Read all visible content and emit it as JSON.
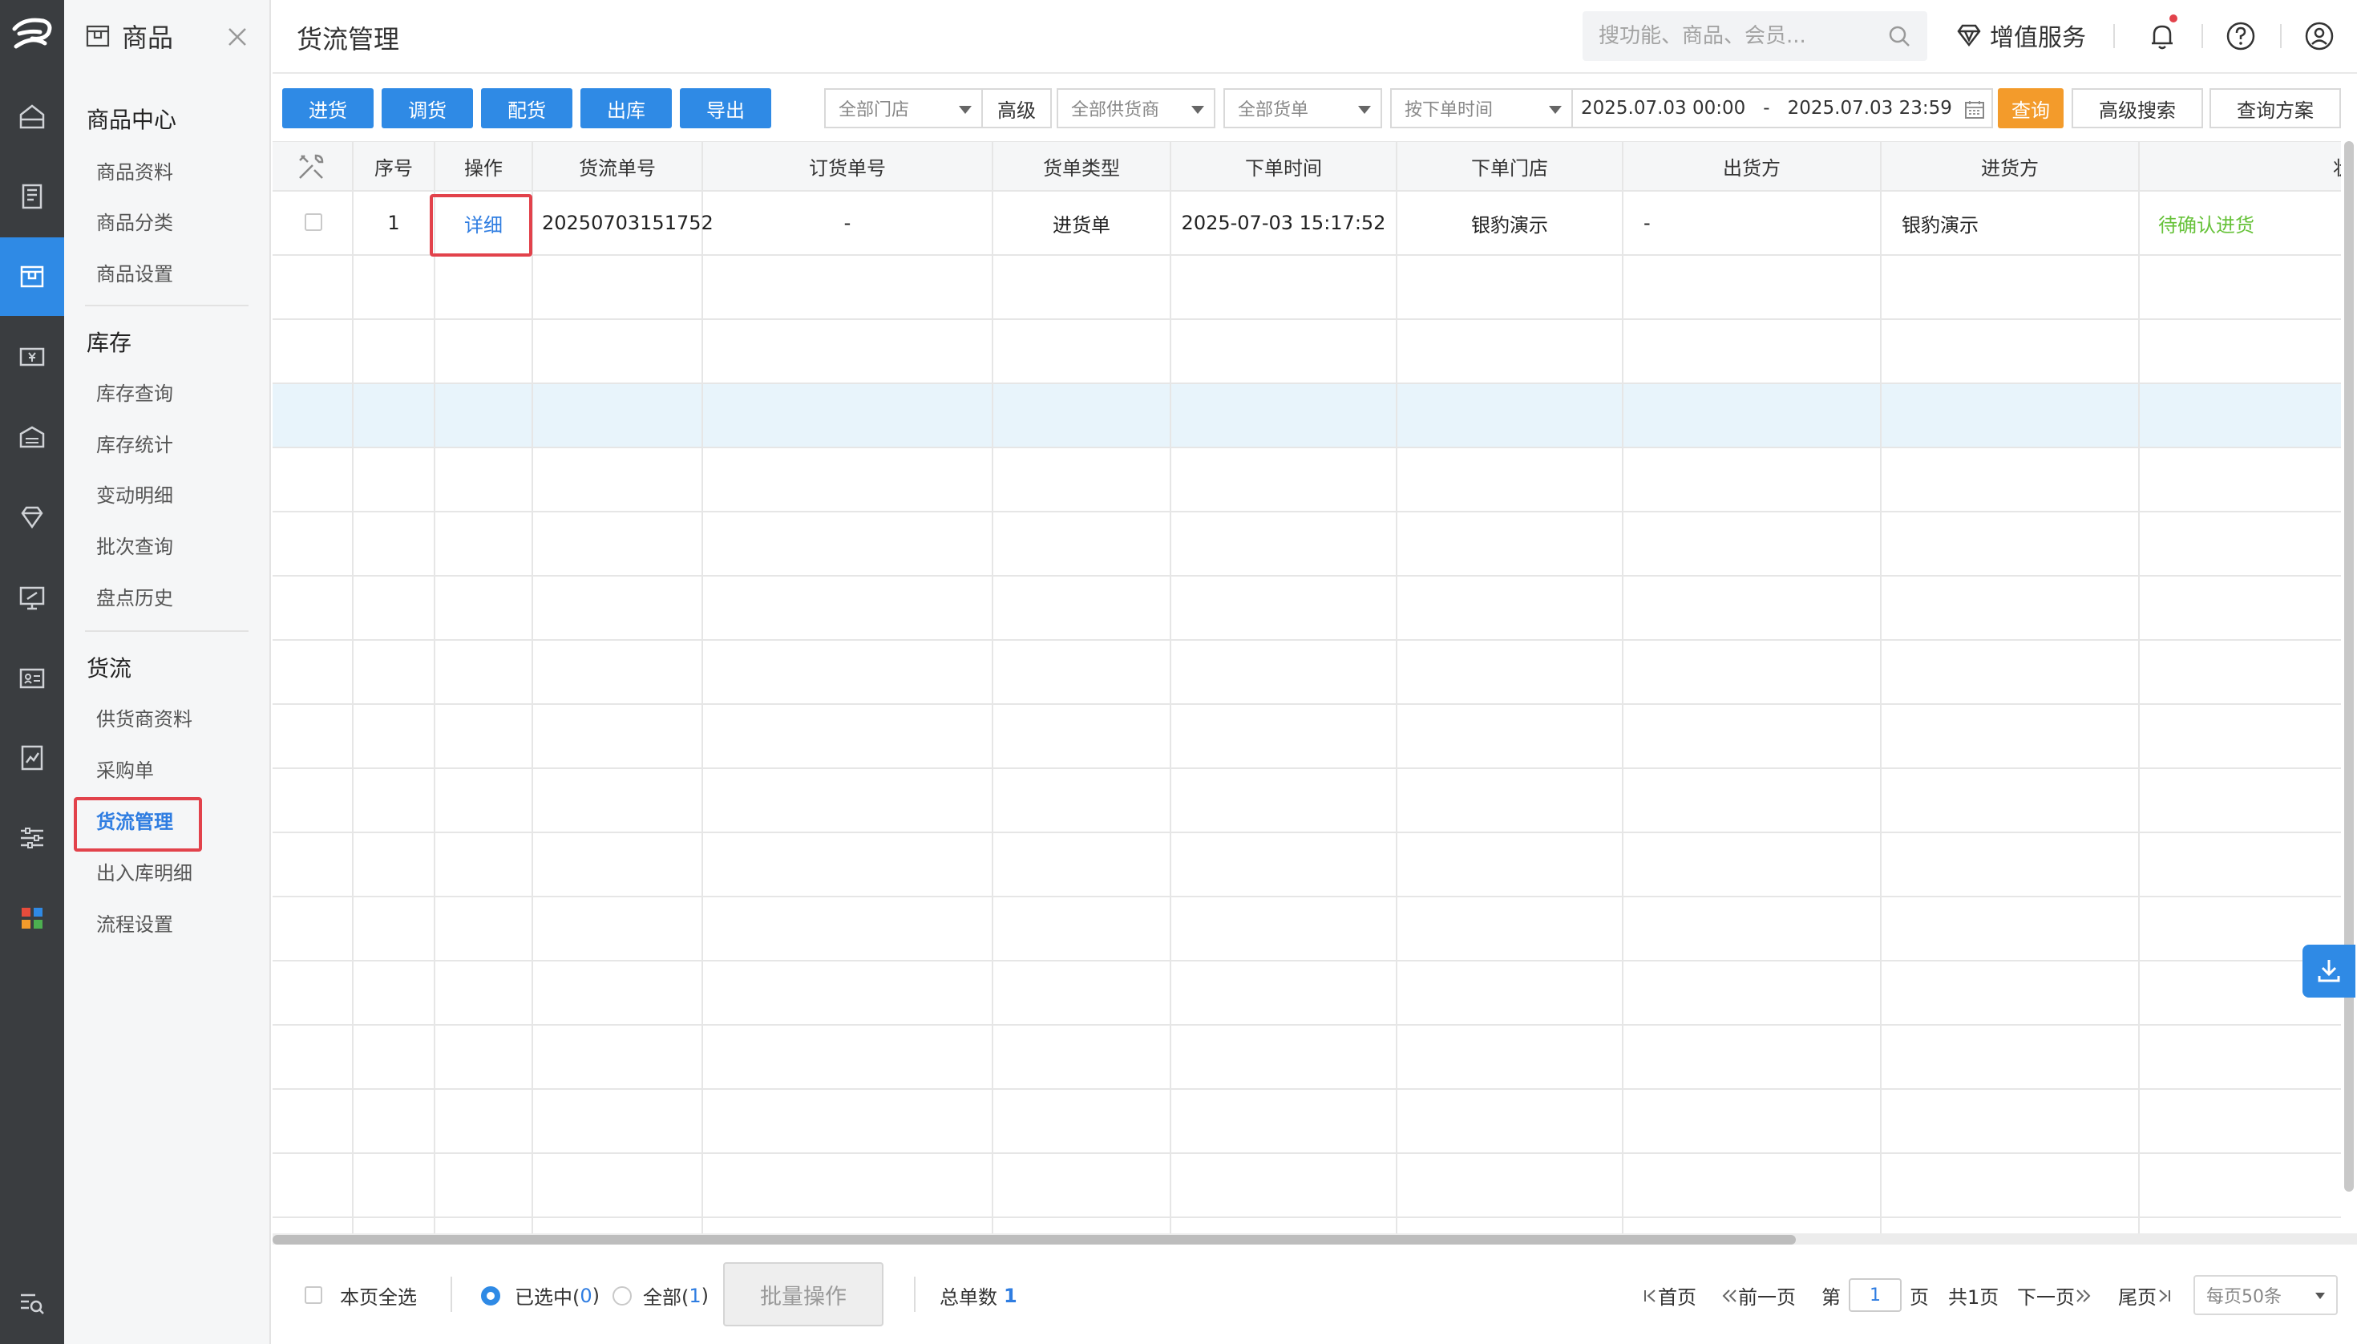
{
  "sidebar": {
    "module_title": "商品",
    "sections": [
      {
        "title": "商品中心",
        "items": [
          "商品资料",
          "商品分类",
          "商品设置"
        ]
      },
      {
        "title": "库存",
        "items": [
          "库存查询",
          "库存统计",
          "变动明细",
          "批次查询",
          "盘点历史"
        ]
      },
      {
        "title": "货流",
        "items": [
          "供货商资料",
          "采购单",
          "货流管理",
          "出入库明细",
          "流程设置"
        ]
      }
    ],
    "active_item": "货流管理"
  },
  "header": {
    "page_title": "货流管理",
    "search_placeholder": "搜功能、商品、会员...",
    "value_added_label": "增值服务"
  },
  "toolbar": {
    "buttons": [
      "进货",
      "调货",
      "配货",
      "出库",
      "导出"
    ],
    "store_filter": "全部门店",
    "advanced_label": "高级",
    "supplier_filter": "全部供货商",
    "order_type_filter": "全部货单",
    "time_filter": "按下单时间",
    "date_from": "2025.07.03 00:00",
    "date_sep": "-",
    "date_to": "2025.07.03 23:59",
    "query_label": "查询",
    "advanced_search_label": "高级搜索",
    "query_plan_label": "查询方案"
  },
  "table": {
    "columns": [
      "序号",
      "操作",
      "货流单号",
      "订货单号",
      "货单类型",
      "下单时间",
      "下单门店",
      "出货方",
      "进货方",
      "状"
    ],
    "rows": [
      {
        "index": "1",
        "action": "详细",
        "flow_no": "20250703151752",
        "order_no": "-",
        "type": "进货单",
        "time": "2025-07-03 15:17:52",
        "store": "银豹演示",
        "shipper": "-",
        "receiver": "银豹演示",
        "status": "待确认进货"
      }
    ]
  },
  "footer": {
    "select_page_label": "本页全选",
    "selected_label": "已选中(",
    "selected_count": "0",
    "all_label": "全部(",
    "all_count": "1",
    "paren_close": ")",
    "batch_label": "批量操作",
    "total_label": "总单数",
    "total_count": "1",
    "first_label": "首页",
    "prev_label": "前一页",
    "page_prefix": "第",
    "page_value": "1",
    "page_suffix": "页",
    "page_total": "共1页",
    "next_label": "下一页",
    "last_label": "尾页",
    "per_page": "每页50条"
  },
  "colors": {
    "primary": "#2f8ae5",
    "query": "#f39b2b",
    "status_pending": "#67c23a",
    "highlight": "#e2424b",
    "rail": "#3a3d40"
  }
}
